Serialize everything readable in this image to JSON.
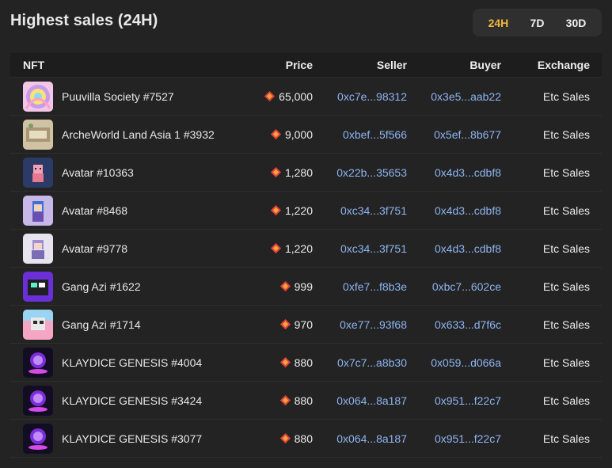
{
  "header": {
    "title": "Highest sales (24H)",
    "periods": [
      "24H",
      "7D",
      "30D"
    ],
    "active_period": "24H"
  },
  "table": {
    "columns": [
      "NFT",
      "Price",
      "Seller",
      "Buyer",
      "Exchange"
    ],
    "rows": [
      {
        "nft": "Puuvilla Society #7527",
        "price": "65,000",
        "seller": "0xc7e...98312",
        "buyer": "0x3e5...aab22",
        "exchange": "Etc Sales"
      },
      {
        "nft": "ArcheWorld Land Asia 1 #3932",
        "price": "9,000",
        "seller": "0xbef...5f566",
        "buyer": "0x5ef...8b677",
        "exchange": "Etc Sales"
      },
      {
        "nft": "Avatar #10363",
        "price": "1,280",
        "seller": "0x22b...35653",
        "buyer": "0x4d3...cdbf8",
        "exchange": "Etc Sales"
      },
      {
        "nft": "Avatar #8468",
        "price": "1,220",
        "seller": "0xc34...3f751",
        "buyer": "0x4d3...cdbf8",
        "exchange": "Etc Sales"
      },
      {
        "nft": "Avatar #9778",
        "price": "1,220",
        "seller": "0xc34...3f751",
        "buyer": "0x4d3...cdbf8",
        "exchange": "Etc Sales"
      },
      {
        "nft": "Gang Azi #1622",
        "price": "999",
        "seller": "0xfe7...f8b3e",
        "buyer": "0xbc7...602ce",
        "exchange": "Etc Sales"
      },
      {
        "nft": "Gang Azi #1714",
        "price": "970",
        "seller": "0xe77...93f68",
        "buyer": "0x633...d7f6c",
        "exchange": "Etc Sales"
      },
      {
        "nft": "KLAYDICE GENESIS #4004",
        "price": "880",
        "seller": "0x7c7...a8b30",
        "buyer": "0x059...d066a",
        "exchange": "Etc Sales"
      },
      {
        "nft": "KLAYDICE GENESIS #3424",
        "price": "880",
        "seller": "0x064...8a187",
        "buyer": "0x951...f22c7",
        "exchange": "Etc Sales"
      },
      {
        "nft": "KLAYDICE GENESIS #3077",
        "price": "880",
        "seller": "0x064...8a187",
        "buyer": "0x951...f22c7",
        "exchange": "Etc Sales"
      }
    ]
  },
  "colors": {
    "accent_active_period": "#f4b73b",
    "address_link": "#8db4f0",
    "panel_bg": "#232323",
    "price_icon": "#e0433a"
  },
  "icons": {
    "price_currency": "klay-token-icon"
  }
}
